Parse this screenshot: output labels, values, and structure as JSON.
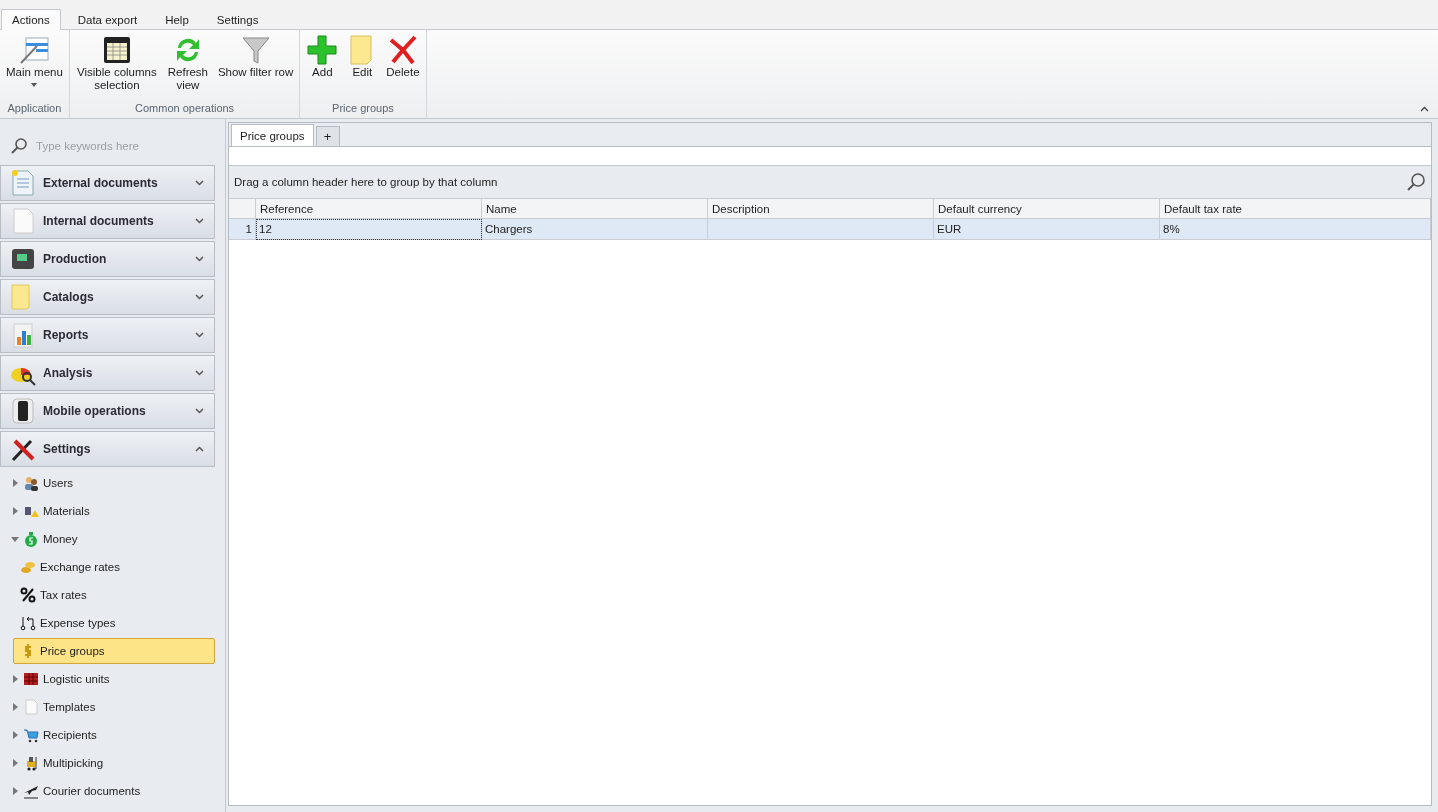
{
  "ribbon_tabs": [
    {
      "label": "Actions",
      "selected": true
    },
    {
      "label": "Data export",
      "selected": false
    },
    {
      "label": "Help",
      "selected": false
    },
    {
      "label": "Settings",
      "selected": false
    }
  ],
  "ribbon_groups": [
    {
      "label": "Application",
      "buttons": [
        {
          "label": "Main menu",
          "dropdown": true
        }
      ]
    },
    {
      "label": "Common operations",
      "buttons": [
        {
          "label": "Visible columns selection",
          "dropdown": false
        },
        {
          "label": "Refresh view",
          "dropdown": false
        },
        {
          "label": "Show filter row",
          "dropdown": false
        }
      ]
    },
    {
      "label": "Price groups",
      "buttons": [
        {
          "label": "Add",
          "dropdown": false
        },
        {
          "label": "Edit",
          "dropdown": false
        },
        {
          "label": "Delete",
          "dropdown": false
        }
      ]
    }
  ],
  "sidebar": {
    "search": {
      "placeholder": "Type keywords here"
    },
    "sections": [
      {
        "label": "External documents",
        "expanded": false
      },
      {
        "label": "Internal documents",
        "expanded": false
      },
      {
        "label": "Production",
        "expanded": false
      },
      {
        "label": "Catalogs",
        "expanded": false
      },
      {
        "label": "Reports",
        "expanded": false
      },
      {
        "label": "Analysis",
        "expanded": false
      },
      {
        "label": "Mobile operations",
        "expanded": false
      },
      {
        "label": "Settings",
        "expanded": true
      }
    ],
    "tree": [
      {
        "label": "Users",
        "expanded": false,
        "selected": false
      },
      {
        "label": "Materials",
        "expanded": false,
        "selected": false
      },
      {
        "label": "Money",
        "expanded": true,
        "selected": false,
        "children": [
          {
            "label": "Exchange rates",
            "selected": false
          },
          {
            "label": "Tax rates",
            "selected": false
          },
          {
            "label": "Expense types",
            "selected": false
          },
          {
            "label": "Price groups",
            "selected": true
          }
        ]
      },
      {
        "label": "Logistic units",
        "expanded": false,
        "selected": false
      },
      {
        "label": "Templates",
        "expanded": false,
        "selected": false
      },
      {
        "label": "Recipients",
        "expanded": false,
        "selected": false
      },
      {
        "label": "Multipicking",
        "expanded": false,
        "selected": false
      },
      {
        "label": "Courier documents",
        "expanded": false,
        "selected": false
      }
    ]
  },
  "doc_tabs": [
    {
      "label": "Price groups",
      "selected": true
    }
  ],
  "add_tab": "+",
  "grid": {
    "group_panel": "Drag a column header here to group by that column",
    "columns": [
      "Reference",
      "Name",
      "Description",
      "Default currency",
      "Default tax rate"
    ],
    "rows": [
      {
        "number": "1",
        "selected": true,
        "cells": [
          "12",
          "Chargers",
          "",
          "EUR",
          "8%"
        ]
      }
    ]
  }
}
